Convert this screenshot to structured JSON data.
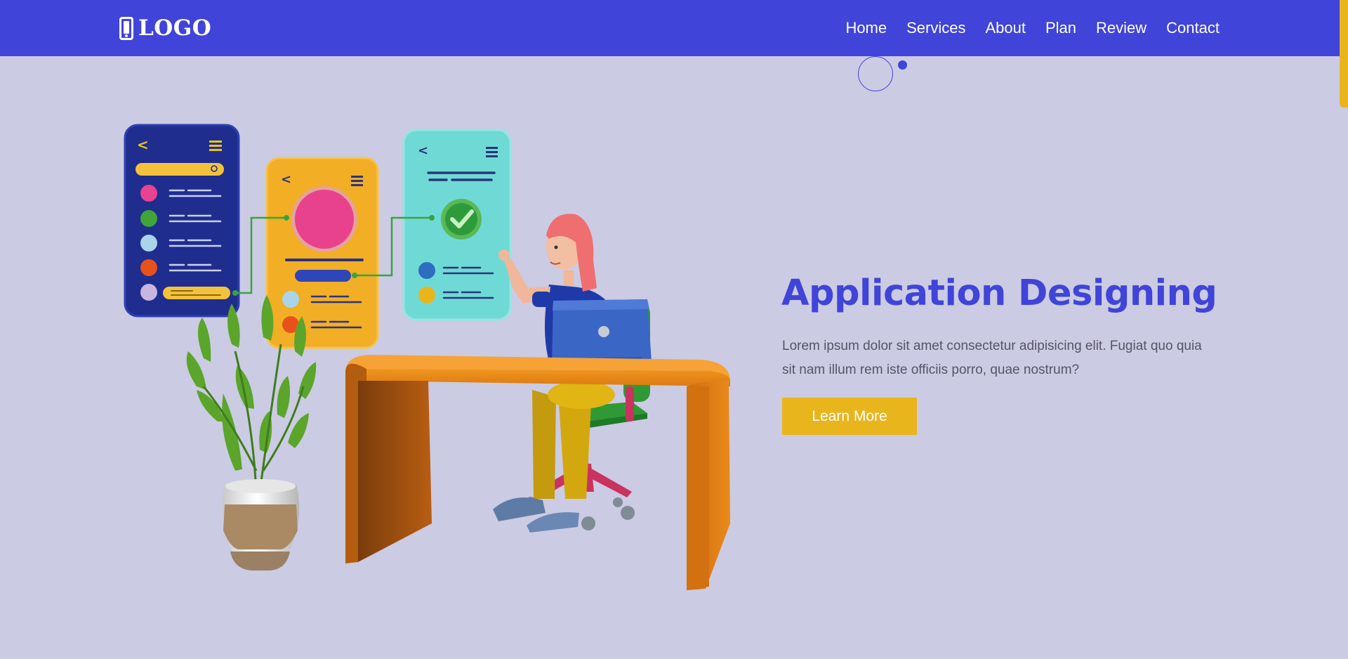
{
  "brand": {
    "logo_text": "LOGO",
    "logo_icon": "mobile-phone-icon"
  },
  "nav": {
    "items": [
      "Home",
      "Services",
      "About",
      "Plan",
      "Review",
      "Contact"
    ]
  },
  "hero": {
    "title": "Application Designing",
    "text": "Lorem ipsum dolor sit amet consectetur adipisicing elit. Fugiat quo quia sit nam illum rem iste officiis porro, quae nostrum?",
    "button_label": "Learn More"
  },
  "colors": {
    "nav_bg": "#4044d8",
    "page_bg": "#cbcbe3",
    "accent": "#e9b51c",
    "title": "#4044d8",
    "body_text": "#555566"
  }
}
